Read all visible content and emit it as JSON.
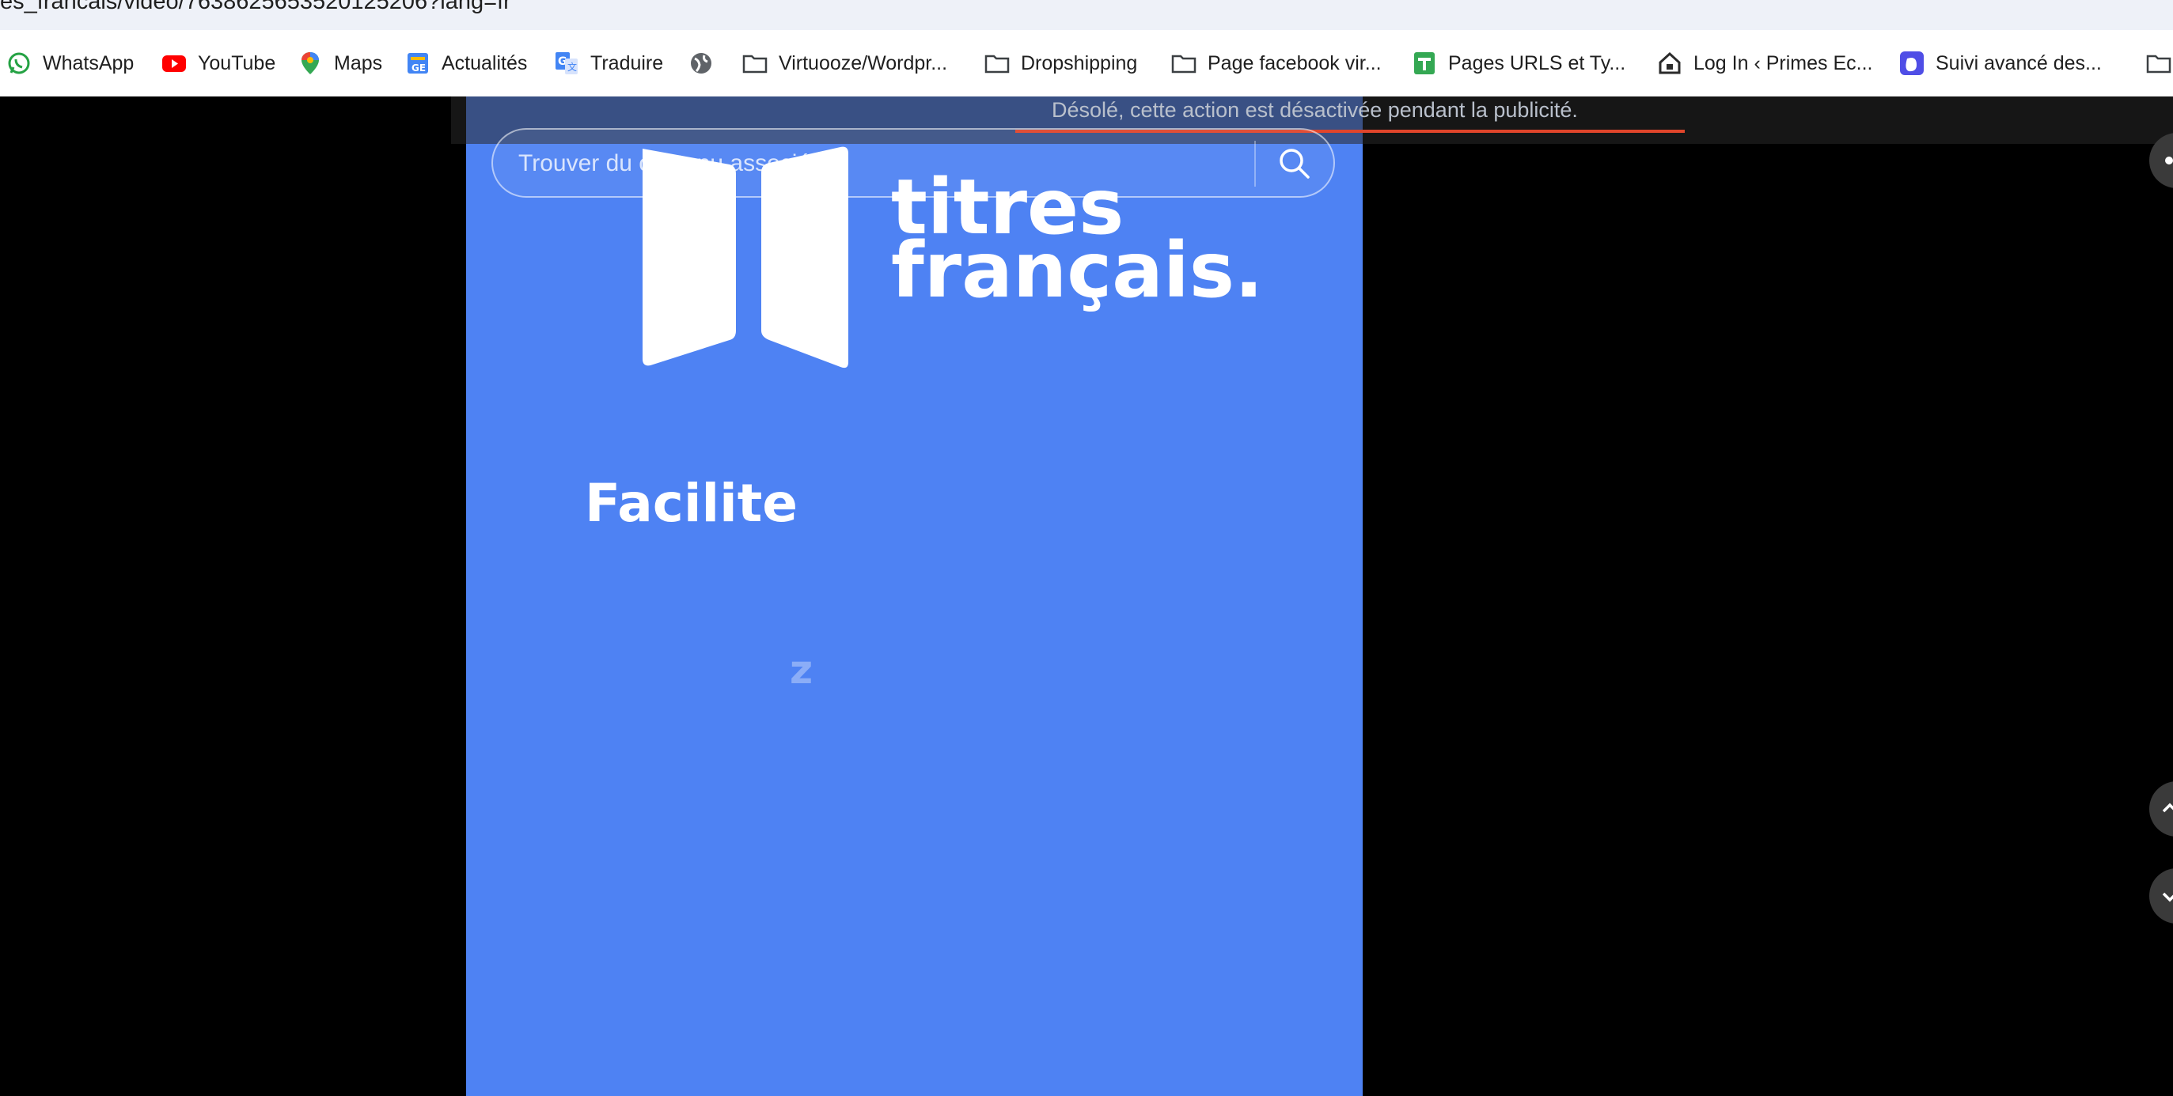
{
  "browser": {
    "url": "es_francais/video/7638625653520125206?lang=fr",
    "bookmarks": [
      {
        "label": "WhatsApp",
        "icon": "whatsapp-icon"
      },
      {
        "label": "YouTube",
        "icon": "youtube-icon"
      },
      {
        "label": "Maps",
        "icon": "maps-icon"
      },
      {
        "label": "Actualités",
        "icon": "google-news-icon"
      },
      {
        "label": "Traduire",
        "icon": "translate-icon"
      },
      {
        "label": "",
        "icon": "globe-icon"
      },
      {
        "label": "Virtuooze/Wordpr...",
        "icon": "folder-icon"
      },
      {
        "label": "Dropshipping",
        "icon": "folder-icon"
      },
      {
        "label": "Page facebook vir...",
        "icon": "folder-icon"
      },
      {
        "label": "Pages URLS et Ty...",
        "icon": "sheets-icon"
      },
      {
        "label": "Log In ‹ Primes Ec...",
        "icon": "house-icon"
      },
      {
        "label": "Suivi avancé des...",
        "icon": "app-icon"
      },
      {
        "label": "",
        "icon": "folder-icon"
      }
    ]
  },
  "player": {
    "toast": "Désolé, cette action est désactivée pendant la publicité.",
    "search_placeholder": "Trouver du contenu associé",
    "logo_line1": "titres",
    "logo_line2": "français.",
    "headline": "Facilite",
    "overlay_char": "z"
  },
  "colors": {
    "video_bg": "#4e82f3",
    "toast_underline": "#e0452b"
  }
}
